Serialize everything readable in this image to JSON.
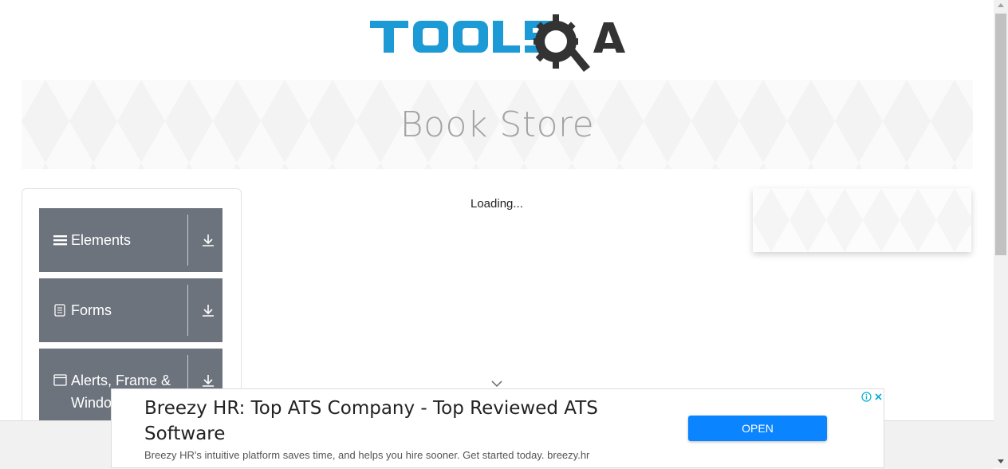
{
  "header": {
    "logo_text": "TOOLSQA",
    "banner_title": "Book Store"
  },
  "sidebar": {
    "groups": [
      {
        "label": "Elements",
        "icon": "hamburger-icon"
      },
      {
        "label": "Forms",
        "icon": "document-icon"
      },
      {
        "label": "Alerts, Frame & Windows",
        "icon": "window-icon"
      }
    ]
  },
  "main": {
    "loading_text": "Loading..."
  },
  "ad": {
    "title": "Breezy HR: Top ATS Company - Top Reviewed ATS Software",
    "subtitle": "Breezy HR's intuitive platform saves time, and helps you hire sooner. Get started today. breezy.hr",
    "button_label": "OPEN"
  },
  "colors": {
    "brand_blue": "#1b9ad6",
    "brand_dark": "#333333",
    "sidebar_bg": "#6c737d",
    "ad_button": "#0a84ff"
  }
}
